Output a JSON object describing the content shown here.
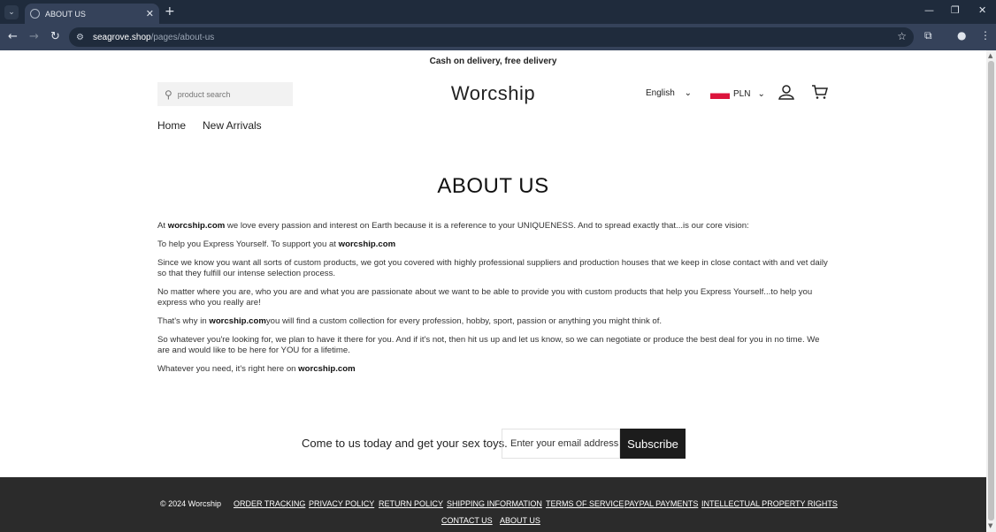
{
  "browser": {
    "tab_title": "ABOUT US",
    "url_host": "seagrove.shop",
    "url_path": "/pages/about-us"
  },
  "store": {
    "announcement": "Cash on delivery, free delivery",
    "logo": "Worcship",
    "search_placeholder": "product search",
    "language": "English",
    "currency": "PLN",
    "nav": [
      "Home",
      "New Arrivals"
    ]
  },
  "page": {
    "title": "ABOUT US",
    "paragraphs": [
      [
        "At ",
        "worcship.com",
        " we love every passion and interest on Earth because it is a reference to your UNIQUENESS. And to spread exactly that...is our core vision:"
      ],
      [
        "To help you Express Yourself. To support you at ",
        "worcship.com",
        ""
      ],
      [
        "Since we know you want all sorts of custom products, we got you covered with highly professional suppliers and production houses that we keep in close contact with and vet daily so that they fulfill our intense selection process.",
        "",
        ""
      ],
      [
        "No matter where you are, who you are and what you are passionate about we want to be able to provide you with custom products that help you Express Yourself...to help you express who you really are!",
        "",
        ""
      ],
      [
        "That's why in ",
        "worcship.com",
        "you will find a custom collection for every profession, hobby, sport, passion or anything you might think of."
      ],
      [
        "So whatever you're looking for, we plan to have it there for you. And if it's not, then hit us up and let us know, so we can negotiate or produce the best deal for you in no time. We are and would like to be here for YOU for a lifetime.",
        "",
        ""
      ],
      [
        "Whatever you need, it's right here on ",
        "worcship.com",
        ""
      ]
    ]
  },
  "newsletter": {
    "text": "Come to us today and get your sex toys.",
    "placeholder": "Enter your email address",
    "button": "Subscribe"
  },
  "footer": {
    "copyright": "© 2024 Worcship",
    "links_row1": [
      "ORDER TRACKING",
      "PRIVACY POLICY",
      "RETURN POLICY",
      "SHIPPING INFORMATION",
      "TERMS OF SERVICE",
      "PAYPAL PAYMENTS",
      "INTELLECTUAL PROPERTY RIGHTS"
    ],
    "links_row2": [
      "CONTACT US",
      "ABOUT US"
    ]
  }
}
